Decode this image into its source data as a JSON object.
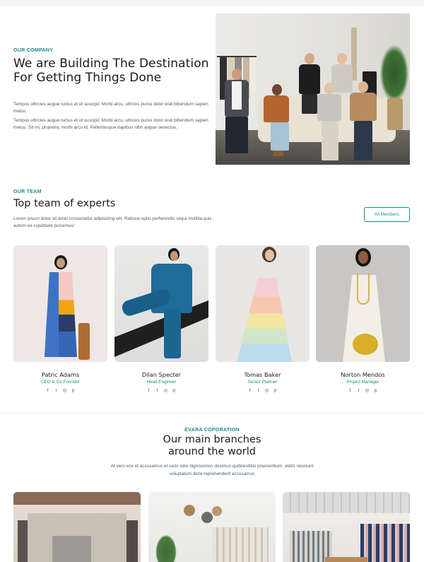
{
  "company": {
    "eyebrow": "OUR COMPANY",
    "title_line1": "We are Building The Destination",
    "title_line2": "For Getting Things Done",
    "paragraph1": "Tempus ultricies augue luctus et ut suscipit. Morbi arcu, ultrices purus dolor erat bibendum sapien metus.",
    "paragraph2": "Tempus ultricies augue luctus et ut suscipit. Morbi arcu, ultrices purus dolor erat bibendum sapien metus. Sit mi, pharetra, morbi arcu id. Pellentesque dapibus nibh augue senectus."
  },
  "team": {
    "eyebrow": "OUR TEAM",
    "title": "Top team of experts",
    "paragraph": "Lorem ipsum dolor sit amet consectetur adipisicing elit. Ratione optio perferendis sequi mollitia quis autem ea cupiditate possimus!",
    "all_members_label": "All Members",
    "members": [
      {
        "name": "Patric Adams",
        "role": "CEO & Co-Founder"
      },
      {
        "name": "Dilan Specter",
        "role": "Head Engineer"
      },
      {
        "name": "Tomas Baker",
        "role": "Senior Planner"
      },
      {
        "name": "Norton Mendos",
        "role": "Project Manager"
      }
    ],
    "social_icons": [
      "facebook-icon",
      "twitter-icon",
      "instagram-icon",
      "pinterest-icon"
    ],
    "social_glyphs": {
      "facebook": "f",
      "twitter": "t",
      "instagram": "◎",
      "pinterest": "p"
    }
  },
  "branches": {
    "eyebrow": "EVARA COPORATION",
    "title_line1": "Our main branches",
    "title_line2": "around the world",
    "paragraph": "At vero eos et accusamus et iusto odio dignissimos ducimus quiblanditiis praesentium. ebitis nesciunt voluptatum dicta reprehenderit accusamus"
  },
  "colors": {
    "accent": "#1e8a86",
    "heading": "#1b1b1b",
    "body_text": "#4f5d6b"
  }
}
